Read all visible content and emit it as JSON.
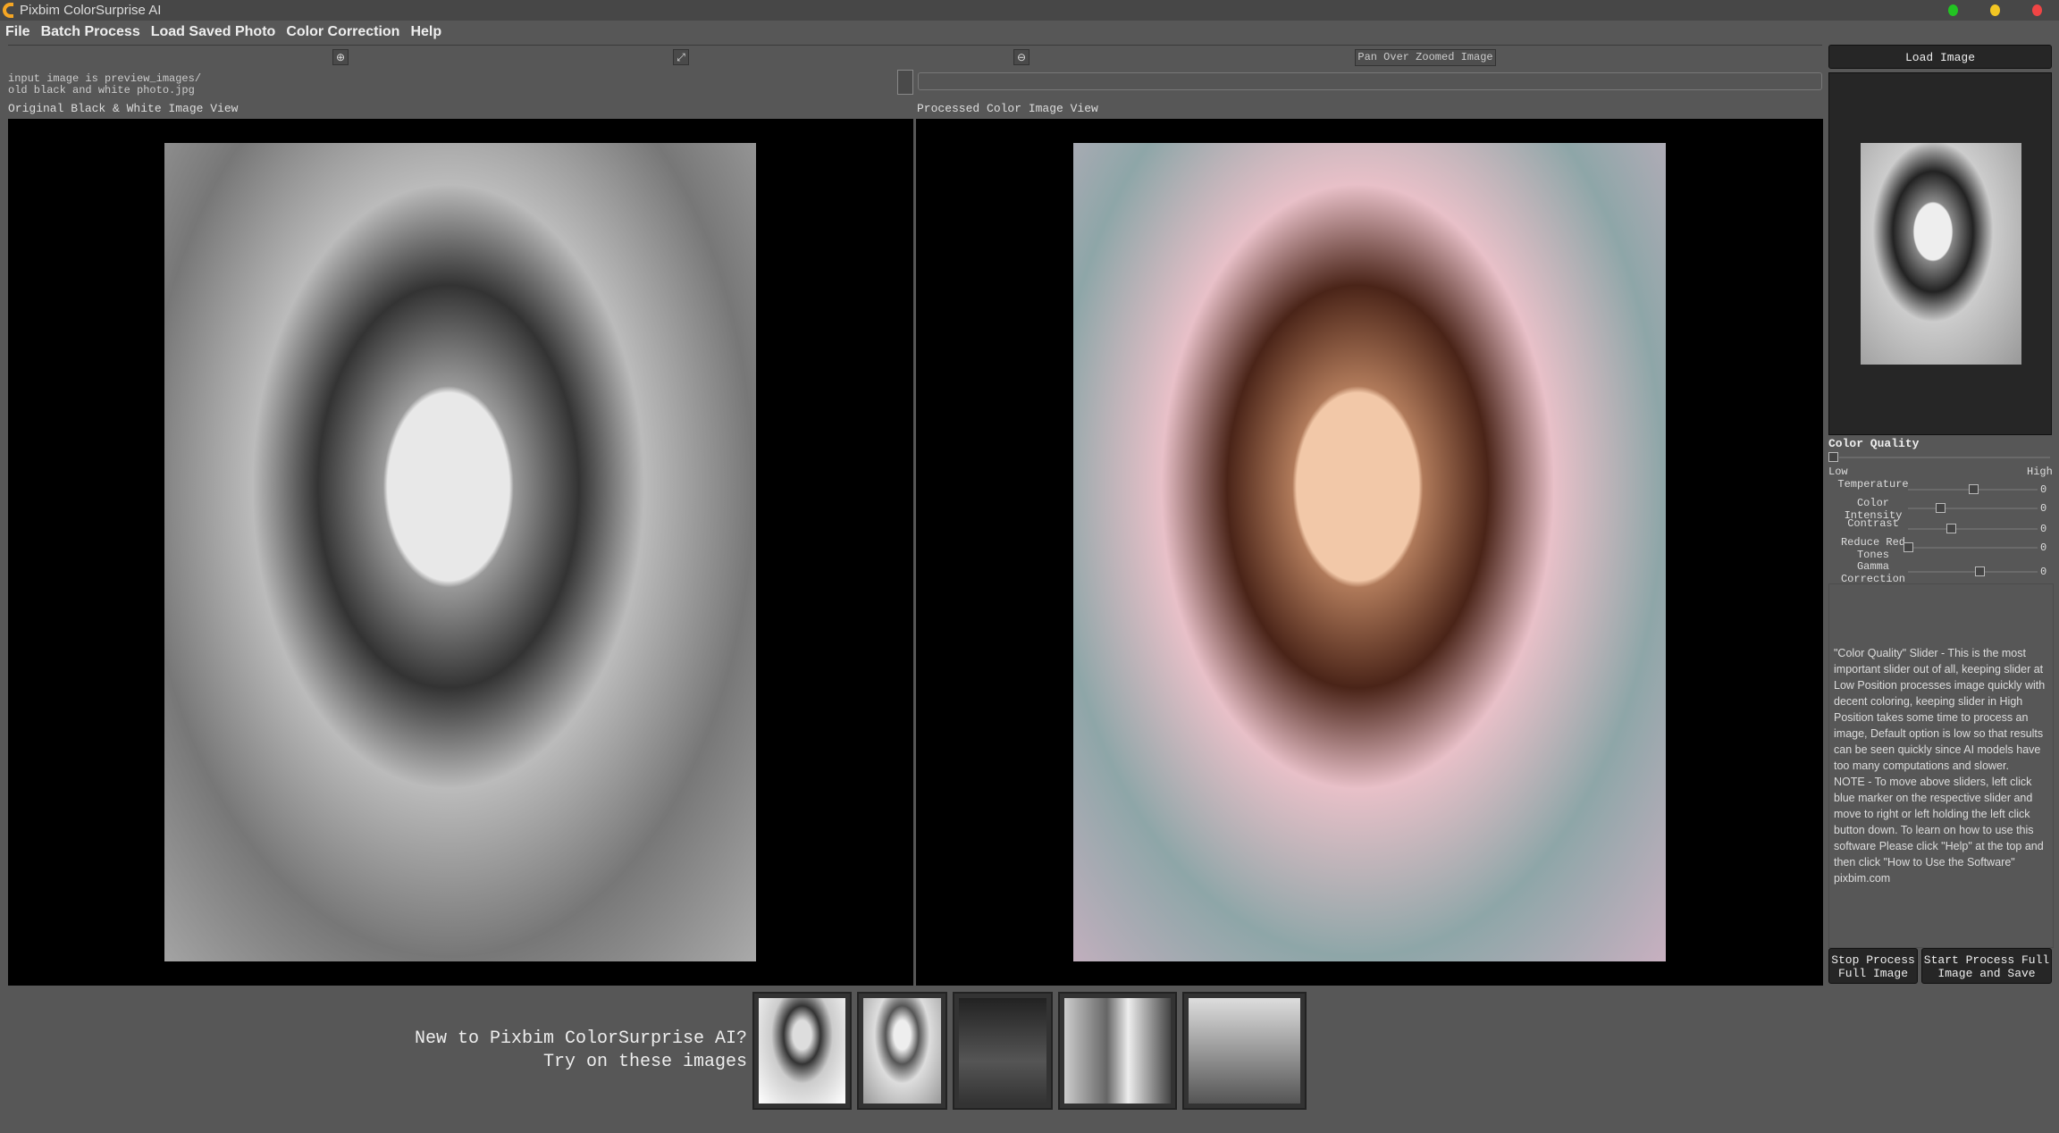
{
  "window": {
    "title": "Pixbim ColorSurprise AI",
    "controls": {
      "green": "#22c322",
      "yellow": "#f3c623",
      "red": "#f04545"
    }
  },
  "menu": [
    "File",
    "Batch Process",
    "Load Saved Photo",
    "Color Correction",
    "Help"
  ],
  "toolbar": {
    "zoom_in_icon": "zoom-in-icon",
    "fit_icon": "expand-icon",
    "zoom_out_icon": "zoom-out-icon",
    "pan_label": "Pan Over Zoomed Image"
  },
  "info": {
    "line1": "input image is preview_images/",
    "line2": "old black and white photo.jpg"
  },
  "views": {
    "left_label": "Original Black & White  Image View",
    "right_label": "Processed Color Image View"
  },
  "sidebar": {
    "load_label": "Load Image",
    "quality": {
      "title": "Color Quality",
      "low": "Low",
      "high": "High",
      "value": 0
    },
    "sliders": [
      {
        "label": "Temperature",
        "value": "0",
        "level": 0.5
      },
      {
        "label": "Color Intensity",
        "value": "0",
        "level": 0.25
      },
      {
        "label": "Contrast",
        "value": "0",
        "level": 0.33
      },
      {
        "label": "Reduce Red Tones",
        "value": "0",
        "level": 0
      },
      {
        "label": "Gamma Correction",
        "value": "0",
        "level": 0.55
      }
    ],
    "help_text": "\"Color Quality\" Slider - This is the most important slider out of all, keeping slider at Low Position processes image quickly with decent coloring, keeping slider in High Position takes some time to process an image, Default option is low so that results can be seen quickly since AI models have too many computations and slower.\nNOTE - To move above sliders, left click blue marker on the respective slider and move to right or left holding the left click button down. To learn on how to use this software Please click \"Help\" at the top and then click \"How to Use the Software\"\npixbim.com",
    "stop_label": "Stop Process\nFull Image",
    "start_label": "Start Process Full\nImage and Save"
  },
  "samples": {
    "line1": "New to Pixbim ColorSurprise AI?",
    "line2": "Try on these images"
  }
}
